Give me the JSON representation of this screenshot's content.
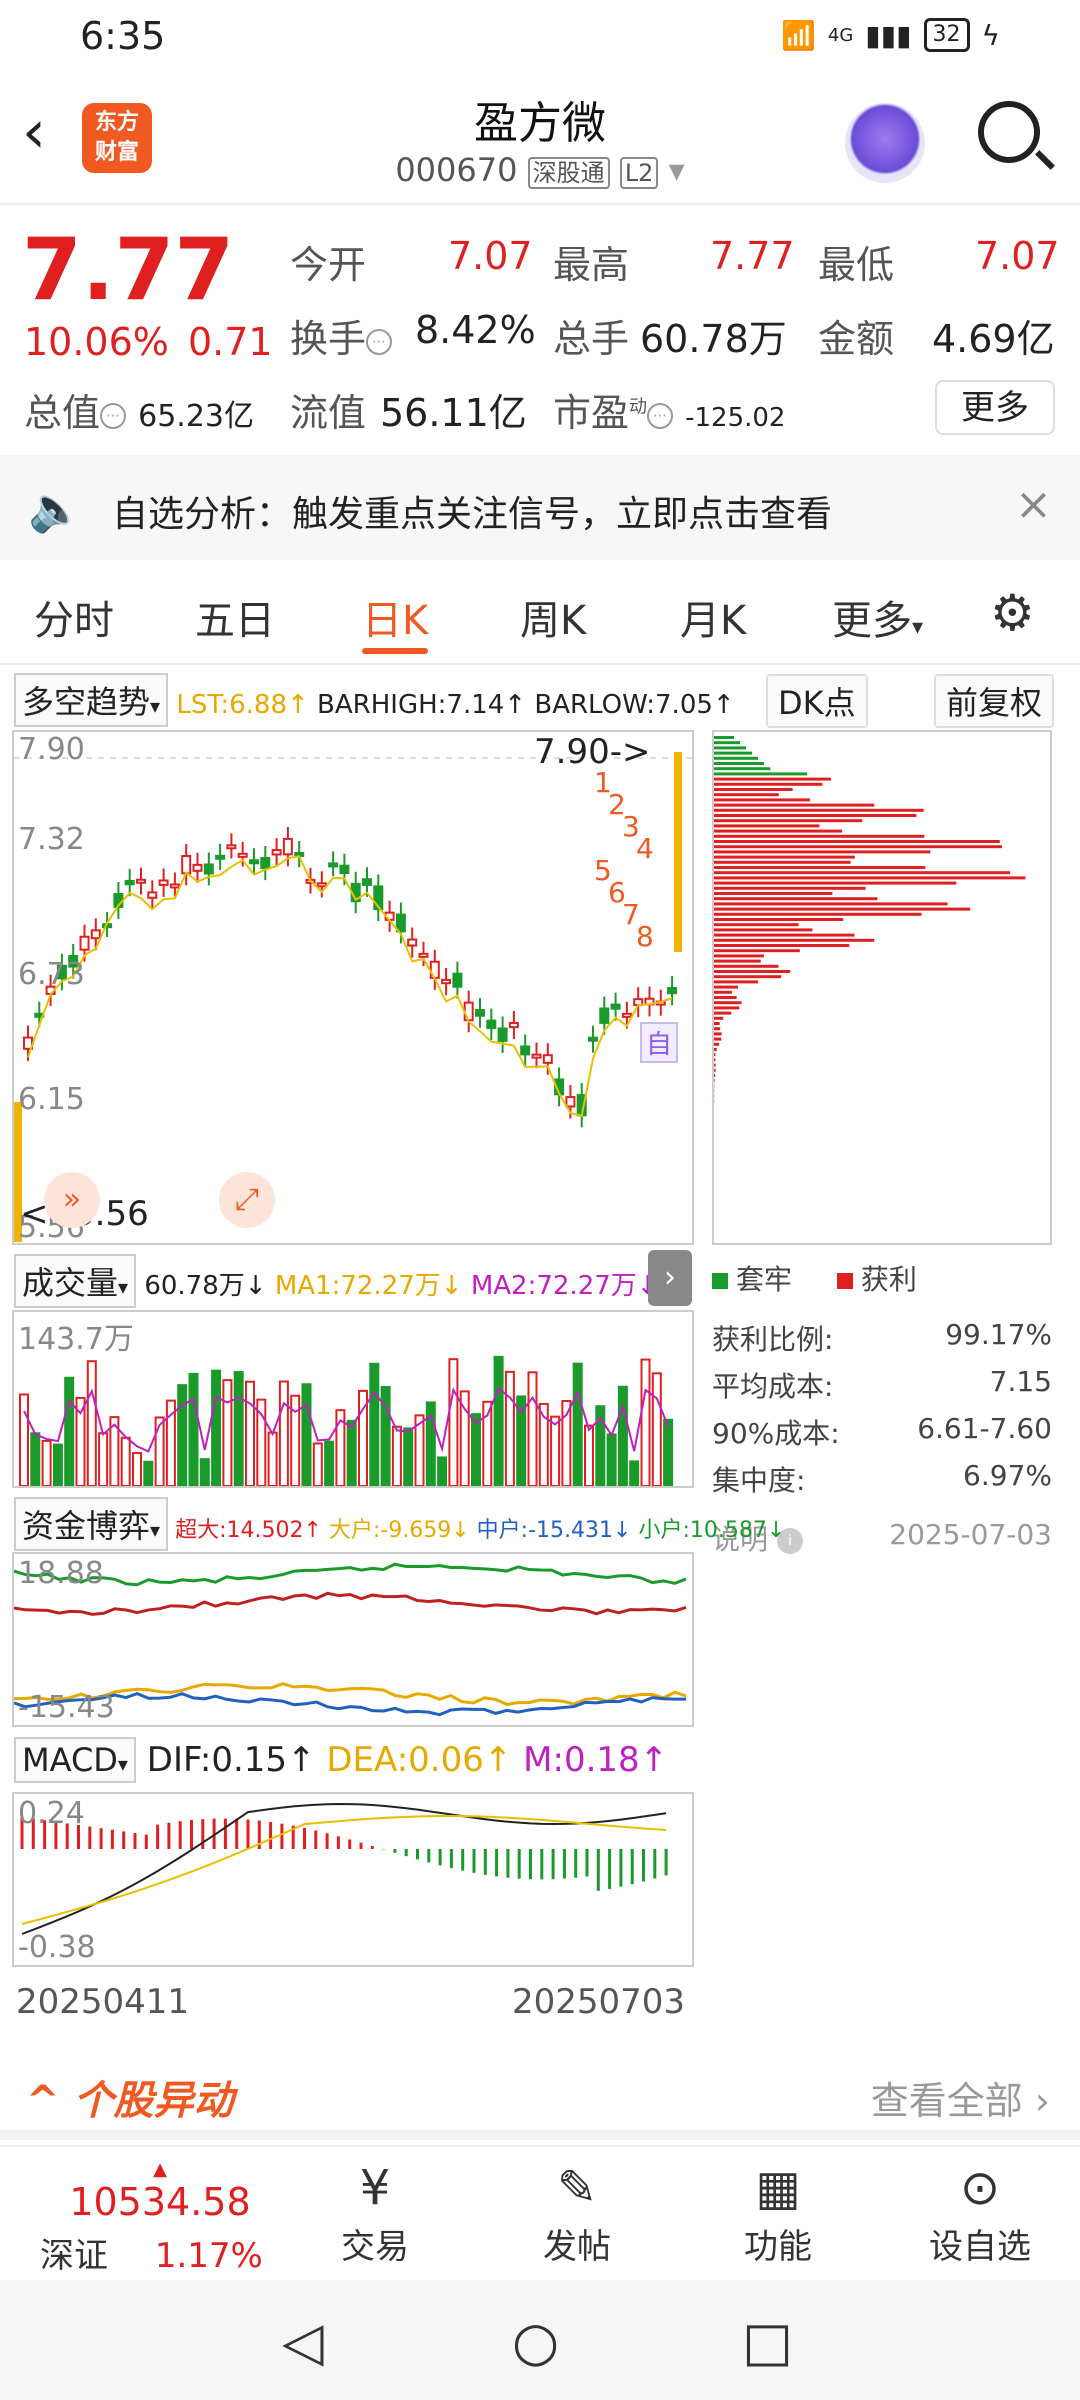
{
  "status": {
    "time": "6:35",
    "network": "4G",
    "battery": "32"
  },
  "header": {
    "logo_line1": "东方",
    "logo_line2": "财富",
    "title": "盈方微",
    "code": "000670",
    "tag1": "深股通",
    "tag2": "L2"
  },
  "quote": {
    "price": "7.77",
    "change_pct": "10.06%",
    "change": "0.71",
    "open_label": "今开",
    "open": "7.07",
    "high_label": "最高",
    "high": "7.77",
    "low_label": "最低",
    "low": "7.07",
    "turnover_label": "换手",
    "turnover": "8.42%",
    "volume_label": "总手",
    "volume": "60.78万",
    "amount_label": "金额",
    "amount": "4.69亿",
    "mktcap_label": "总值",
    "mktcap": "65.23亿",
    "float_label": "流值",
    "float": "56.11亿",
    "pe_label": "市盈",
    "pe_sup": "动",
    "pe": "-125.02",
    "more": "更多"
  },
  "alert": {
    "text": "自选分析：触发重点关注信号，立即点击查看",
    "close": "×"
  },
  "tabs": {
    "items": [
      "分时",
      "五日",
      "日K",
      "周K",
      "月K",
      "更多"
    ],
    "active": "日K"
  },
  "kline": {
    "indicator": "多空趋势",
    "lst": "LST:6.88↑",
    "barhigh": "BARHIGH:7.14↑",
    "barlow": "BARLOW:7.05↑",
    "dk": "DK点",
    "adjust": "前复权",
    "y_labels": [
      "7.90",
      "7.32",
      "6.73",
      "6.15",
      "5.56"
    ],
    "high_mark": "7.90->",
    "low_mark": "<--5.56",
    "signals": [
      "1",
      "2",
      "3",
      "4",
      "5",
      "6",
      "7",
      "8"
    ],
    "self_tag": "自"
  },
  "volume": {
    "indicator": "成交量",
    "value": "60.78万↓",
    "ma1": "MA1:72.27万↓",
    "ma2": "MA2:72.27万↓",
    "top_label": "143.7万"
  },
  "fund": {
    "indicator": "资金博弈",
    "super": "超大:14.502↑",
    "big": "大户:-9.659↓",
    "mid": "中户:-15.431↓",
    "small": "小户:10.587↓",
    "top": "18.88",
    "bottom": "-15.43"
  },
  "macd": {
    "indicator": "MACD",
    "dif": "DIF:0.15↑",
    "dea": "DEA:0.06↑",
    "m": "M:0.18↑",
    "top": "0.24",
    "bottom": "-0.38"
  },
  "dates": {
    "start": "20250411",
    "end": "20250703"
  },
  "chips": {
    "legend_trapped": "套牢",
    "legend_profit": "获利",
    "rows": [
      {
        "label": "获利比例:",
        "value": "99.17%"
      },
      {
        "label": "平均成本:",
        "value": "7.15"
      },
      {
        "label": "90%成本:",
        "value": "6.61-7.60"
      },
      {
        "label": "集中度:",
        "value": "6.97%"
      }
    ],
    "note": "说明",
    "date": "2025-07-03"
  },
  "anomaly": {
    "title": "个股异动",
    "all": "查看全部"
  },
  "bottombar": {
    "index_value": "10534.58",
    "index_name": "深证",
    "index_pct": "1.17%",
    "items": [
      "交易",
      "发帖",
      "功能",
      "设自选"
    ]
  },
  "colors": {
    "up": "#e02020",
    "down": "#1a9a2a",
    "accent": "#f05a22"
  }
}
